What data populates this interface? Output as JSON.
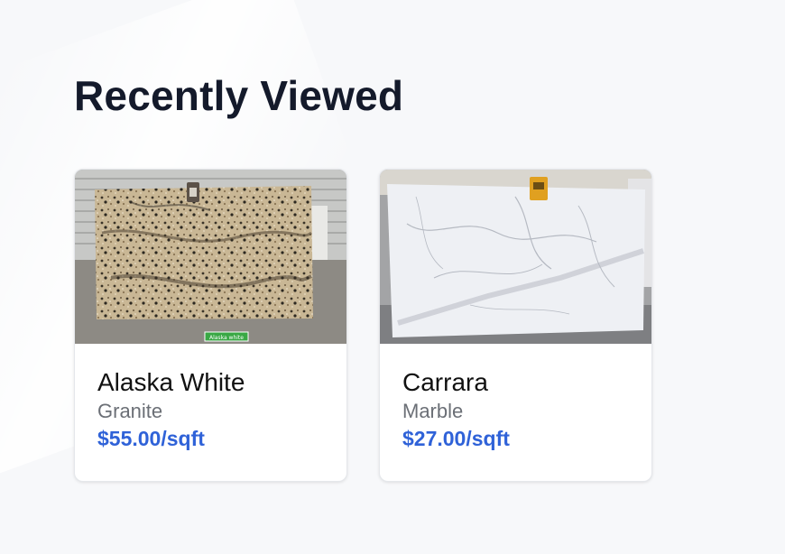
{
  "section": {
    "title": "Recently Viewed"
  },
  "products": [
    {
      "name": "Alaska White",
      "type": "Granite",
      "price": "$55.00/sqft",
      "image_label": "Alaska white"
    },
    {
      "name": "Carrara",
      "type": "Marble",
      "price": "$27.00/sqft"
    }
  ],
  "colors": {
    "title": "#141a2b",
    "price": "#2f62d8",
    "type": "#6b6f76",
    "background": "#f7f8fa"
  }
}
